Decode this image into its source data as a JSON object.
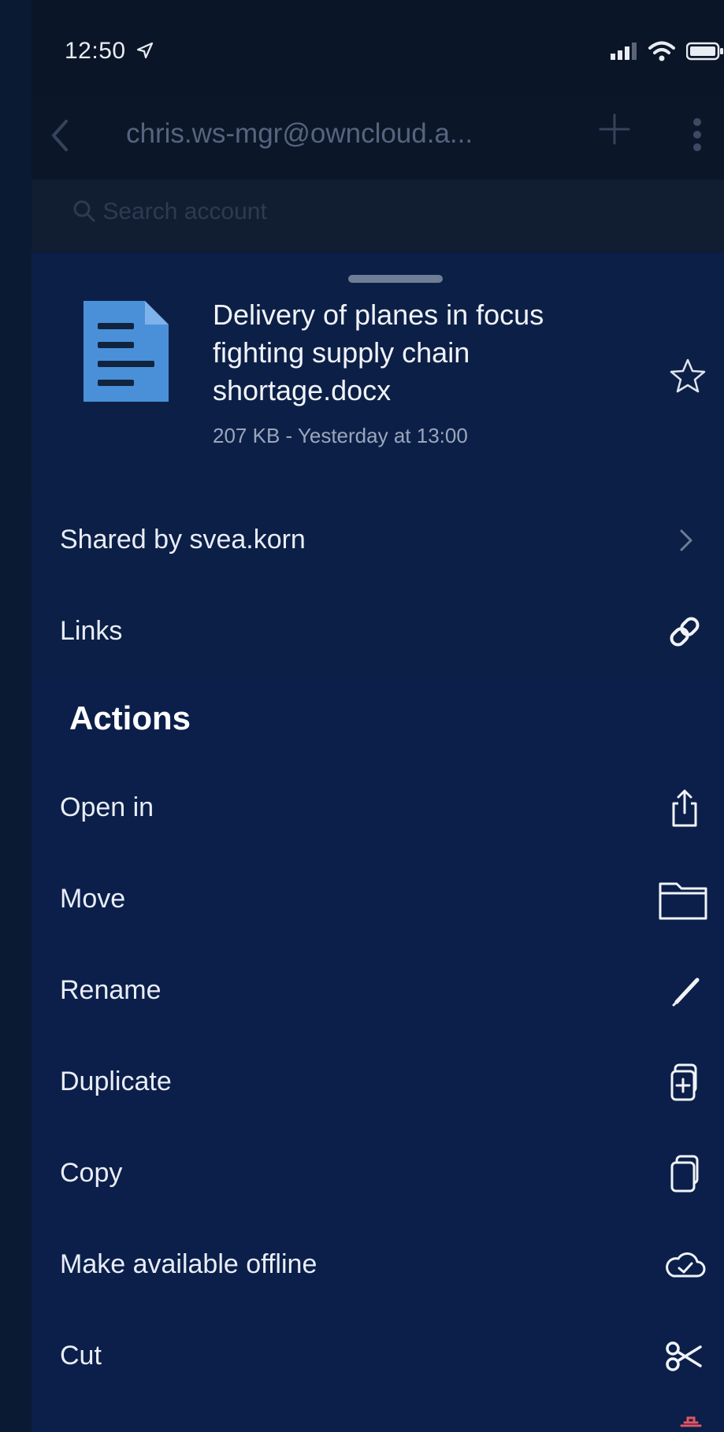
{
  "status_bar": {
    "time": "12:50",
    "location_icon": "location-arrow-icon",
    "signal_icon": "cellular-signal-icon",
    "wifi_icon": "wifi-icon",
    "battery_icon": "battery-icon"
  },
  "nav": {
    "back_icon": "chevron-left-icon",
    "title": "chris.ws-mgr@owncloud.a...",
    "add_icon": "plus-icon",
    "more_icon": "more-vertical-icon",
    "search_placeholder": "Search account"
  },
  "file": {
    "icon": "document-icon",
    "name": "Delivery of planes in focus fighting supply chain shortage.docx",
    "meta": "207 KB - Yesterday at 13:00",
    "favorite_icon": "star-icon",
    "accent_color": "#4a90d9"
  },
  "sharing": {
    "shared_by": "Shared by svea.korn",
    "shared_by_icon": "chevron-right-icon",
    "links": "Links",
    "links_icon": "link-icon"
  },
  "actions": {
    "title": "Actions",
    "items": [
      {
        "label": "Open in",
        "icon": "share-icon"
      },
      {
        "label": "Move",
        "icon": "folder-icon"
      },
      {
        "label": "Rename",
        "icon": "pencil-icon"
      },
      {
        "label": "Duplicate",
        "icon": "duplicate-icon"
      },
      {
        "label": "Copy",
        "icon": "copy-icon"
      },
      {
        "label": "Make available offline",
        "icon": "cloud-check-icon"
      },
      {
        "label": "Cut",
        "icon": "scissors-icon"
      }
    ]
  }
}
